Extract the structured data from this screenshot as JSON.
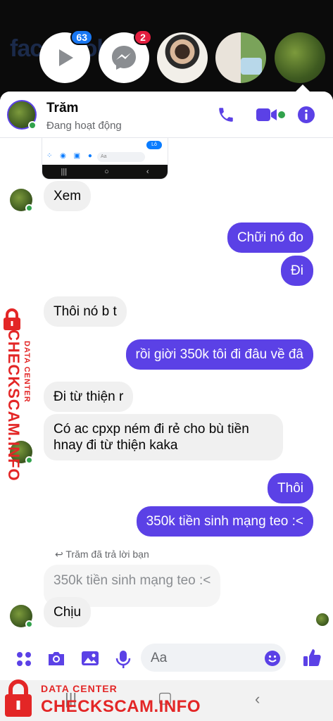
{
  "chat_heads": {
    "bg_wordmark": "facebook",
    "video_badge": "63",
    "messenger_badge": "2"
  },
  "header": {
    "name": "Trăm",
    "status": "Đang hoạt động",
    "accent": "#5b41e6",
    "online_color": "#31a24c"
  },
  "screenshot_preview": {
    "input_placeholder": "Aa",
    "blob_text": "Lô"
  },
  "messages": [
    {
      "side": "in",
      "text": "Xem"
    },
    {
      "side": "out",
      "text": "Chữi nó đo"
    },
    {
      "side": "out",
      "text": "Đi"
    },
    {
      "side": "in",
      "text": "Thôi nó b t"
    },
    {
      "side": "out",
      "text": "rồi giời 350k tôi đi đâu về đâ"
    },
    {
      "side": "in",
      "text": "Đi từ thiện r"
    },
    {
      "side": "in",
      "text": "Có ac cpxp ném đi rẻ cho bù tiền hnay đi từ thiện kaka"
    },
    {
      "side": "out",
      "text": "Thôi"
    },
    {
      "side": "out",
      "text": "350k tiền sinh mạng teo :<"
    },
    {
      "side": "in",
      "text": "Chịu"
    }
  ],
  "reply": {
    "note": "Trăm đã trả lời bạn",
    "quoted": "350k tiền sinh mạng teo :<"
  },
  "composer": {
    "placeholder": "Aa"
  },
  "watermark": {
    "brand": "CHECKSCAM.INFO",
    "tagline": "DATA CENTER",
    "color": "#e32626"
  }
}
